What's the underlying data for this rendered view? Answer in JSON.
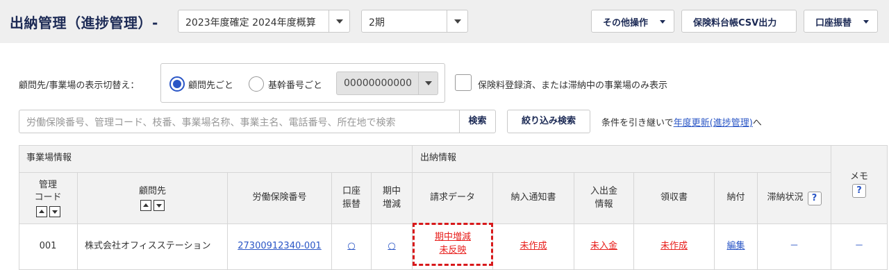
{
  "header": {
    "title": "出納管理（進捗管理）-",
    "year_select": "2023年度確定 2024年度概算",
    "period_select": "2期",
    "buttons": {
      "other_ops": "その他操作",
      "csv_export": "保険料台帳CSV出力",
      "account_transfer": "口座振替"
    }
  },
  "filters": {
    "toggle_label": "顧問先/事業場の表示切替え：",
    "radio_client": "顧問先ごと",
    "radio_trunk": "基幹番号ごと",
    "trunk_code": "00000000000",
    "checkbox_label": "保険料登録済、または滞納中の事業場のみ表示"
  },
  "search": {
    "placeholder": "労働保険番号、管理コード、枝番、事業場名称、事業主名、電話番号、所在地で検索",
    "search_button": "検索",
    "filter_button": "絞り込み検索",
    "carry_prefix": "条件を引き継いで",
    "carry_link": "年度更新(進捗管理)",
    "carry_suffix": "へ"
  },
  "table": {
    "groups": {
      "site_info": "事業場情報",
      "cash_info": "出納情報",
      "memo": "メモ"
    },
    "columns": {
      "mgmt_code": "管理\nコード",
      "client": "顧問先",
      "insurance_no": "労働保険番号",
      "account_transfer": "口座\n振替",
      "midterm": "期中\n増減",
      "billing": "請求データ",
      "payment_notice": "納入通知書",
      "cash_io": "入出金\n情報",
      "receipt": "領収書",
      "payment": "納付",
      "arrears": "滞納状況"
    },
    "help_glyph": "?",
    "rows": [
      {
        "mgmt_code": "001",
        "client": "株式会社オフィスステーション",
        "insurance_no": "27300912340-001",
        "account_transfer": "○",
        "midterm": "○",
        "billing_line1": "期中増減",
        "billing_line2": "未反映",
        "payment_notice": "未作成",
        "cash_io": "未入金",
        "receipt": "未作成",
        "payment": "編集",
        "arrears": "－",
        "memo": "－"
      }
    ]
  },
  "colors": {
    "title": "#1c2a55",
    "link": "#2a56c6",
    "alert": "#e8201d",
    "highlight_border": "#d8191b"
  }
}
